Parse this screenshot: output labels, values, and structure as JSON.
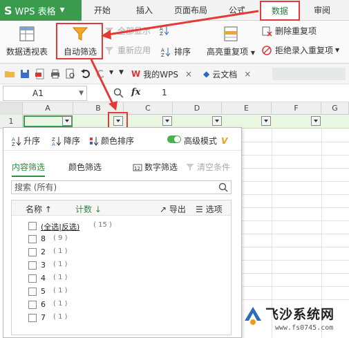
{
  "app_menu": {
    "label": "WPS 表格"
  },
  "ribbon_tabs": [
    {
      "label": "开始"
    },
    {
      "label": "插入"
    },
    {
      "label": "页面布局"
    },
    {
      "label": "公式"
    },
    {
      "label": "数据",
      "active": true
    },
    {
      "label": "审阅"
    }
  ],
  "ribbon": {
    "pivot": "数据透视表",
    "autofilter": "自动筛选",
    "show_all": "全部显示",
    "reapply": "重新应用",
    "sort": "排序",
    "highlight_dup": "高亮重复项",
    "remove_dup": "删除重复项",
    "reject_dup": "拒绝录入重复项"
  },
  "doc_tabs": [
    {
      "label": "我的WPS"
    },
    {
      "label": "云文档"
    }
  ],
  "formula_bar": {
    "cell_ref": "A1",
    "fx": "fx",
    "value": "1"
  },
  "columns": [
    "A",
    "B",
    "C",
    "D",
    "E",
    "F",
    "G"
  ],
  "row_number": "1",
  "filter_popup": {
    "sort_asc": "升序",
    "sort_desc": "降序",
    "color_sort": "颜色排序",
    "advanced_mode": "高级模式",
    "tabs": [
      "内容筛选",
      "颜色筛选"
    ],
    "number_filter": "数字筛选",
    "clear_condition": "清空条件",
    "search_placeholder": "搜索 (所有)",
    "col_name": "名称",
    "col_count": "计数",
    "export": "导出",
    "options": "选项",
    "select_all": "(全选|反选)",
    "select_all_count": "( 15 )",
    "items": [
      {
        "label": "8",
        "count": "( 9 )"
      },
      {
        "label": "2",
        "count": "( 1 )"
      },
      {
        "label": "3",
        "count": "( 1 )"
      },
      {
        "label": "4",
        "count": "( 1 )"
      },
      {
        "label": "5",
        "count": "( 1 )"
      },
      {
        "label": "6",
        "count": "( 1 )"
      },
      {
        "label": "7",
        "count": "( 1 )"
      }
    ]
  },
  "watermark": {
    "title": "飞沙系统网",
    "url": "www.fs0745.com"
  },
  "colors": {
    "brand_green": "#3a9b4f",
    "highlight_red": "#e53935",
    "accent_green": "#2e8b3e"
  }
}
